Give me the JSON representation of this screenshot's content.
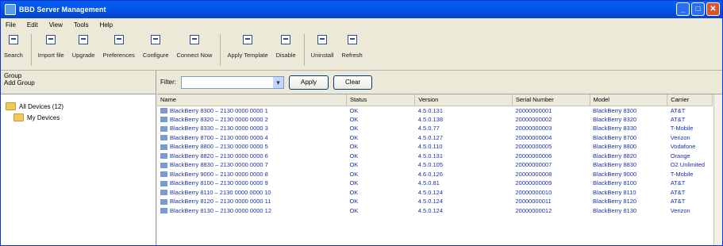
{
  "window": {
    "title": "BBD Server Management",
    "buttons": [
      "_",
      "□",
      "✕"
    ]
  },
  "menu": [
    "File",
    "Edit",
    "View",
    "Tools",
    "Help"
  ],
  "toolbar": [
    "Search",
    "Import file",
    "Upgrade",
    "Preferences",
    "Configure",
    "Connect Now",
    "Apply Template",
    "Disable",
    "Uninstall",
    "Refresh"
  ],
  "left": {
    "header": "Group",
    "sub_header": "Add Group",
    "tree": [
      "All Devices (12)",
      "My Devices"
    ]
  },
  "filter": {
    "label": "Filter:",
    "value": "",
    "apply": "Apply",
    "clear": "Clear"
  },
  "table": {
    "headers": [
      "Name",
      "Status",
      "Version",
      "Serial Number",
      "Model",
      "Carrier"
    ],
    "rows": [
      [
        "BlackBerry 8300 – 2130 0000 0000 1",
        "OK",
        "4.5.0.131",
        "20000000001",
        "BlackBerry 8300",
        "AT&T"
      ],
      [
        "BlackBerry 8320 – 2130 0000 0000 2",
        "OK",
        "4.5.0.138",
        "20000000002",
        "BlackBerry 8320",
        "AT&T"
      ],
      [
        "BlackBerry 8330 – 2130 0000 0000 3",
        "OK",
        "4.5.0.77",
        "20000000003",
        "BlackBerry 8330",
        "T-Mobile"
      ],
      [
        "BlackBerry 8700 – 2130 0000 0000 4",
        "OK",
        "4.5.0.127",
        "20000000004",
        "BlackBerry 8700",
        "Verizon"
      ],
      [
        "BlackBerry 8800 – 2130 0000 0000 5",
        "OK",
        "4.5.0.110",
        "20000000005",
        "BlackBerry 8800",
        "Vodafone"
      ],
      [
        "BlackBerry 8820 – 2130 0000 0000 6",
        "OK",
        "4.5.0.131",
        "20000000006",
        "BlackBerry 8820",
        "Orange"
      ],
      [
        "BlackBerry 8830 – 2130 0000 0000 7",
        "OK",
        "4.5.0.105",
        "20000000007",
        "BlackBerry 8830",
        "O2 Unlimited"
      ],
      [
        "BlackBerry 9000 – 2130 0000 0000 8",
        "OK",
        "4.6.0.126",
        "20000000008",
        "BlackBerry 9000",
        "T-Mobile"
      ],
      [
        "BlackBerry 8100 – 2130 0000 0000 9",
        "OK",
        "4.5.0.81",
        "20000000009",
        "BlackBerry 8100",
        "AT&T"
      ],
      [
        "BlackBerry 8110 – 2130 0000 0000 10",
        "OK",
        "4.5.0.124",
        "20000000010",
        "BlackBerry 8110",
        "AT&T"
      ],
      [
        "BlackBerry 8120 – 2130 0000 0000 11",
        "OK",
        "4.5.0.124",
        "20000000011",
        "BlackBerry 8120",
        "AT&T"
      ],
      [
        "BlackBerry 8130 – 2130 0000 0000 12",
        "OK",
        "4.5.0.124",
        "20000000012",
        "BlackBerry 8130",
        "Verizon"
      ]
    ]
  }
}
